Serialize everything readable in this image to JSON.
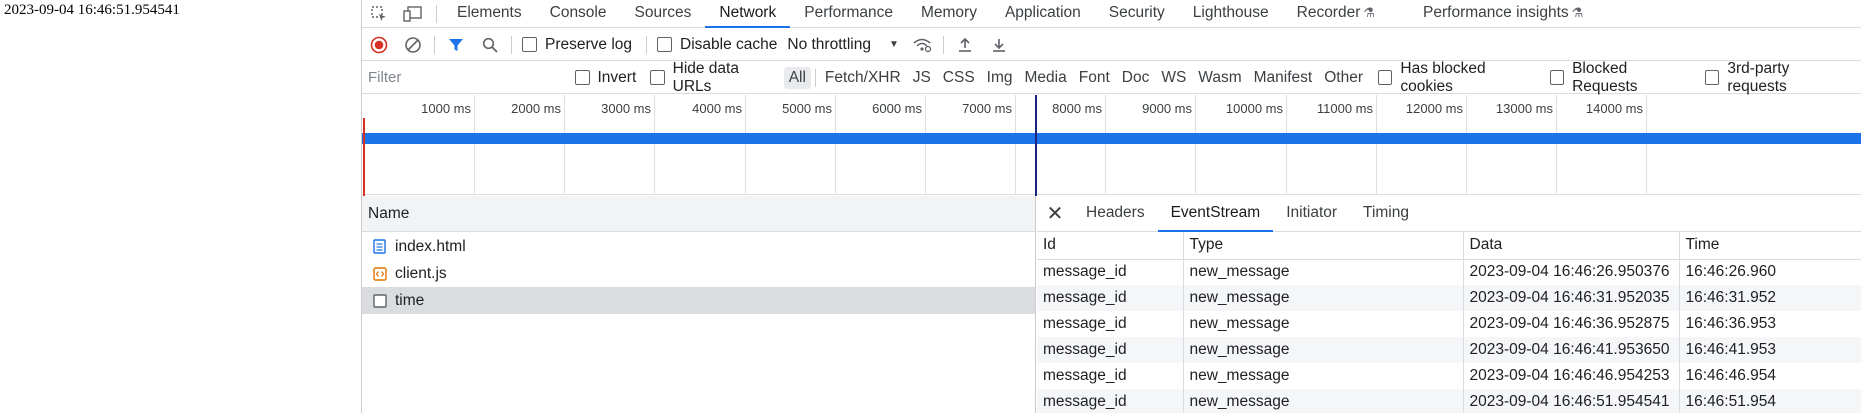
{
  "page": {
    "text": "2023-09-04 16:46:51.954541"
  },
  "tabs": [
    {
      "label": "Elements"
    },
    {
      "label": "Console"
    },
    {
      "label": "Sources"
    },
    {
      "label": "Network"
    },
    {
      "label": "Performance"
    },
    {
      "label": "Memory"
    },
    {
      "label": "Application"
    },
    {
      "label": "Security"
    },
    {
      "label": "Lighthouse"
    },
    {
      "label": "Recorder"
    },
    {
      "label": "Performance insights"
    }
  ],
  "toolbar": {
    "preserve_log": "Preserve log",
    "disable_cache": "Disable cache",
    "throttling": "No throttling"
  },
  "filter": {
    "placeholder": "Filter",
    "invert": "Invert",
    "hide_data_urls": "Hide data URLs",
    "types": [
      "All",
      "Fetch/XHR",
      "JS",
      "CSS",
      "Img",
      "Media",
      "Font",
      "Doc",
      "WS",
      "Wasm",
      "Manifest",
      "Other"
    ],
    "has_blocked_cookies": "Has blocked cookies",
    "blocked_requests": "Blocked Requests",
    "third_party": "3rd-party requests"
  },
  "timeline": {
    "ticks": [
      "1000 ms",
      "2000 ms",
      "3000 ms",
      "4000 ms",
      "5000 ms",
      "6000 ms",
      "7000 ms",
      "8000 ms",
      "9000 ms",
      "10000 ms",
      "11000 ms",
      "12000 ms",
      "13000 ms",
      "14000 ms"
    ]
  },
  "requests": {
    "header": "Name",
    "items": [
      "index.html",
      "client.js",
      "time"
    ]
  },
  "detail": {
    "tabs": [
      "Headers",
      "EventStream",
      "Initiator",
      "Timing"
    ],
    "columns": [
      "Id",
      "Type",
      "Data",
      "Time"
    ],
    "rows": [
      [
        "message_id",
        "new_message",
        "2023-09-04 16:46:26.950376",
        "16:46:26.960"
      ],
      [
        "message_id",
        "new_message",
        "2023-09-04 16:46:31.952035",
        "16:46:31.952"
      ],
      [
        "message_id",
        "new_message",
        "2023-09-04 16:46:36.952875",
        "16:46:36.953"
      ],
      [
        "message_id",
        "new_message",
        "2023-09-04 16:46:41.953650",
        "16:46:41.953"
      ],
      [
        "message_id",
        "new_message",
        "2023-09-04 16:46:46.954253",
        "16:46:46.954"
      ],
      [
        "message_id",
        "new_message",
        "2023-09-04 16:46:51.954541",
        "16:46:51.954"
      ]
    ]
  },
  "colors": {
    "accent": "#1a73e8",
    "record": "#d93025",
    "marker": "#1a237e"
  }
}
